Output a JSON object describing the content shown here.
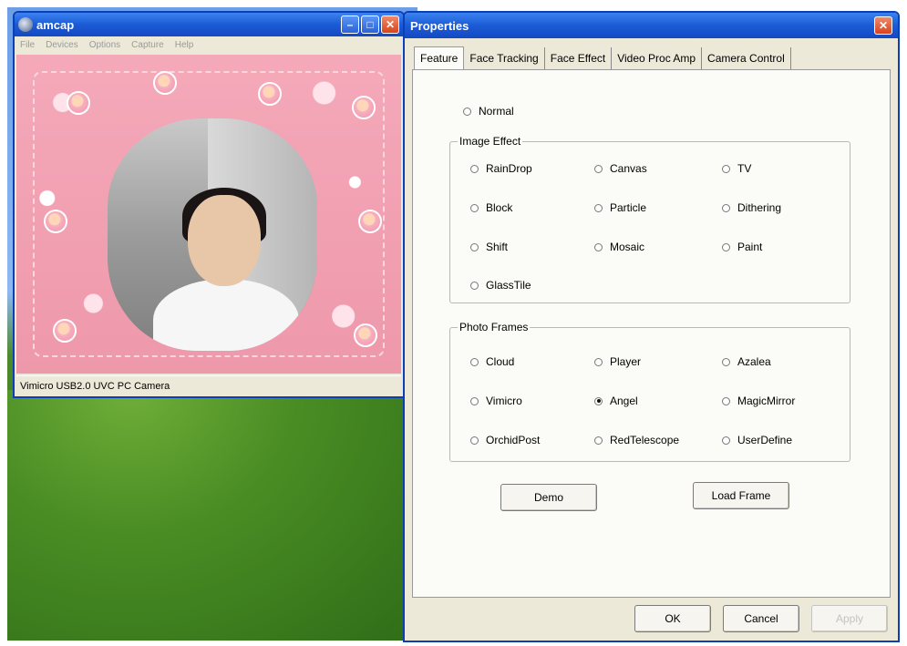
{
  "amcap": {
    "title": "amcap",
    "menu": [
      "File",
      "Devices",
      "Options",
      "Capture",
      "Help"
    ],
    "status": "Vimicro USB2.0 UVC PC Camera",
    "buttons": {
      "minimize": "–",
      "maximize": "□",
      "close": "✕"
    }
  },
  "properties": {
    "title": "Properties",
    "close": "✕",
    "tabs": [
      "Feature",
      "Face Tracking",
      "Face Effect",
      "Video Proc Amp",
      "Camera Control"
    ],
    "normal_label": "Normal",
    "image_effect": {
      "label": "Image Effect",
      "options": [
        "RainDrop",
        "Canvas",
        "TV",
        "Block",
        "Particle",
        "Dithering",
        "Shift",
        "Mosaic",
        "Paint",
        "GlassTile"
      ]
    },
    "photo_frames": {
      "label": "Photo Frames",
      "options": [
        "Cloud",
        "Player",
        "Azalea",
        "Vimicro",
        "Angel",
        "MagicMirror",
        "OrchidPost",
        "RedTelescope",
        "UserDefine"
      ],
      "selected": "Angel"
    },
    "demo_button": "Demo",
    "load_frame_button": "Load Frame",
    "ok_button": "OK",
    "cancel_button": "Cancel",
    "apply_button": "Apply"
  }
}
